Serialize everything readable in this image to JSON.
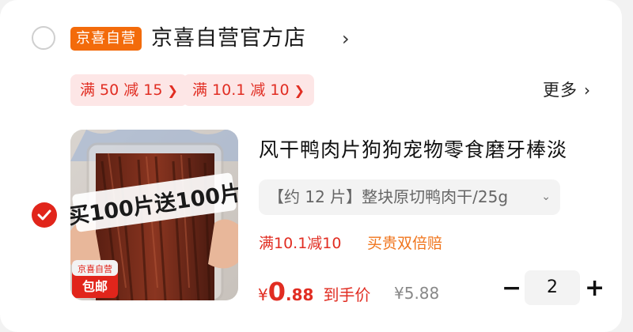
{
  "store": {
    "badge": "京喜自营",
    "name": "京喜自营官方店",
    "arrow": "›"
  },
  "coupons": [
    {
      "label": "满 50 减 15"
    },
    {
      "label": "满 10.1 减 10"
    }
  ],
  "more_label": "更多",
  "product": {
    "image_overlay_text": "买100片送100片",
    "image_badge_top": "京喜自营",
    "image_badge_bottom": "包邮",
    "title": "风干鸭肉片狗狗宠物零食磨牙棒淡",
    "spec": "【约 12 片】整块原切鸭肉干/25g",
    "promo": "满10.1减10",
    "guarantee": "买贵双倍赔",
    "price_symbol": "¥",
    "price_int": "0",
    "price_dec": ".88",
    "price_tag": "到手价",
    "original_price": "¥5.88",
    "selected": true
  },
  "quantity": {
    "minus": "−",
    "value": "2",
    "plus": "+"
  },
  "colors": {
    "accent_red": "#e1251b",
    "store_badge": "#f36b0b",
    "coupon_bg": "#fde6e6",
    "guarantee_orange": "#f0741b"
  },
  "icons": {
    "store_checkbox": "circle-unchecked",
    "item_checkbox": "check-circle-filled",
    "spec_dropdown": "chevron-down"
  }
}
